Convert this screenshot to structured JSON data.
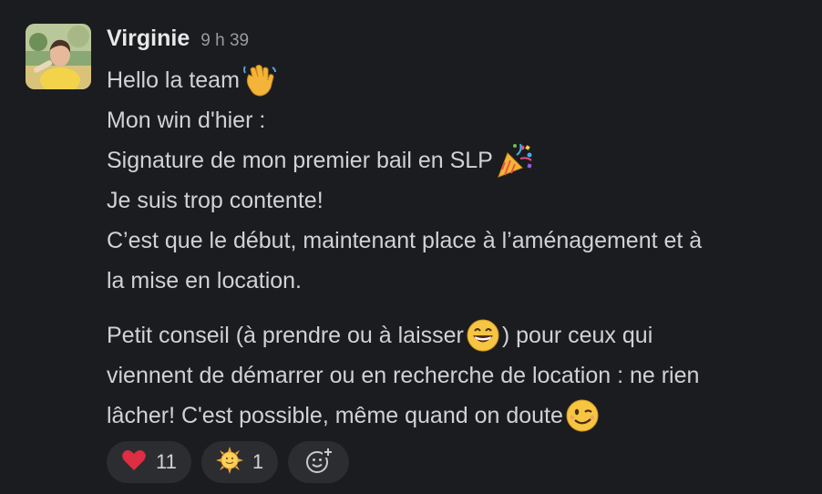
{
  "message": {
    "author": "Virginie",
    "time": "9 h 39",
    "lines_para1": [
      {
        "text": "Hello la team ",
        "emoji": "waving-hand"
      },
      {
        "text": "Mon win d'hier :",
        "emoji": null
      },
      {
        "text": "Signature de mon premier bail en SLP",
        "emoji": "party-popper"
      },
      {
        "text": "Je suis trop contente!",
        "emoji": null
      },
      {
        "text": "C’est que le début, maintenant place à l’aménagement et à",
        "emoji": null
      },
      {
        "text": "la mise en location.",
        "emoji": null
      }
    ],
    "para2": {
      "line1_before": "Petit conseil (à prendre ou à laisser ",
      "line1_after": ") pour ceux qui",
      "line2": "viennent de démarrer ou en recherche de location : ne rien",
      "line3": "lâcher! C'est possible, même quand on doute "
    }
  },
  "reactions": [
    {
      "emoji": "heart",
      "count": "11"
    },
    {
      "emoji": "sun-with-face",
      "count": "1"
    }
  ],
  "add_reaction_icon": "add-reaction-icon",
  "colors": {
    "background": "#1b1c1f",
    "text": "#d1d2d3",
    "pill": "#2c2d31",
    "timestamp": "#9a9b9e"
  }
}
